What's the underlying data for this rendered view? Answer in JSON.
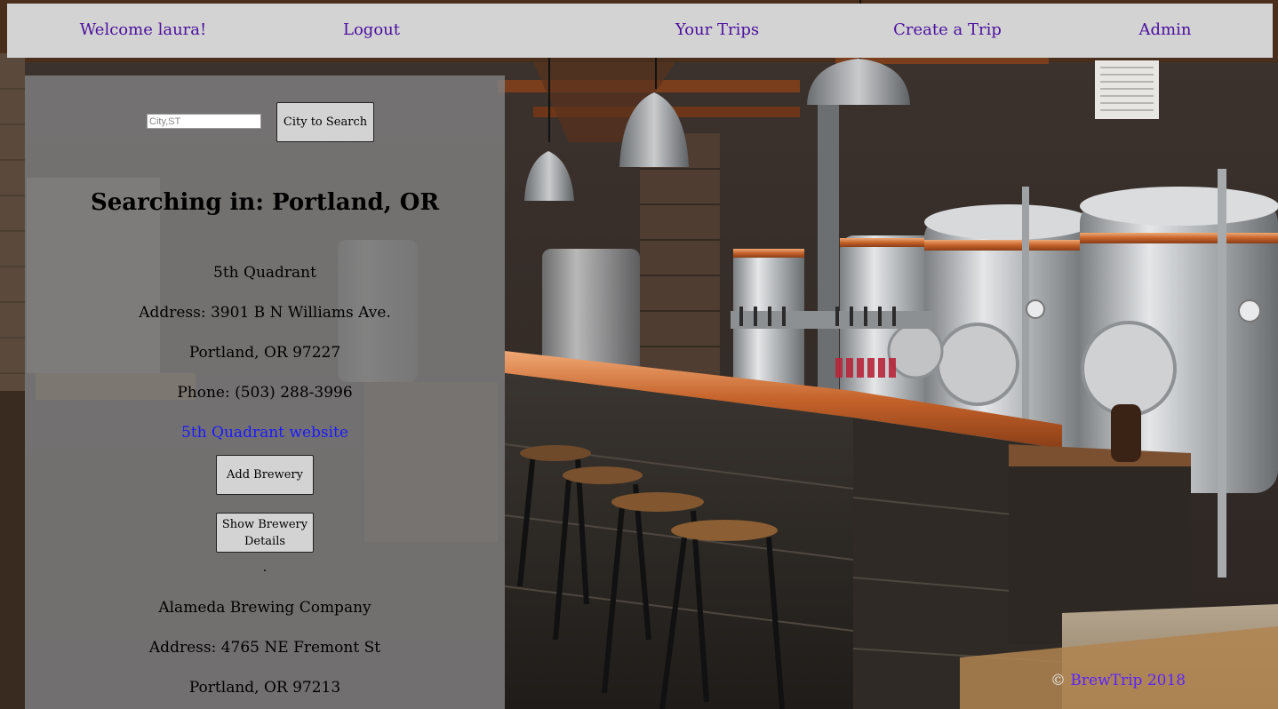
{
  "nav": {
    "welcome": "Welcome laura!",
    "logout": "Logout",
    "your_trips": "Your Trips",
    "create_trip": "Create a Trip",
    "admin": "Admin"
  },
  "search": {
    "placeholder": "City,ST",
    "button_label": "City to Search",
    "heading": "Searching in: Portland, OR"
  },
  "breweries": [
    {
      "name": "5th Quadrant",
      "address": "Address: 3901 B N Williams Ave.",
      "city_line": "Portland, OR 97227",
      "phone": "Phone: (503) 288-3996",
      "website_label": "5th Quadrant website",
      "add_label": "Add Brewery",
      "details_label_1": "Show Brewery",
      "details_label_2": "Details"
    },
    {
      "name": "Alameda Brewing Company",
      "address": "Address: 4765 NE Fremont St",
      "city_line": "Portland, OR 97213"
    }
  ],
  "footer": {
    "copyright": "©",
    "link": "BrewTrip 2018"
  },
  "colors": {
    "nav_bg": "#d3d3d3",
    "nav_link": "#4b0f9e",
    "panel_bg": "rgba(128,128,128,0.82)",
    "website_link": "#1a1aff",
    "footer_link": "#5a23ff"
  }
}
